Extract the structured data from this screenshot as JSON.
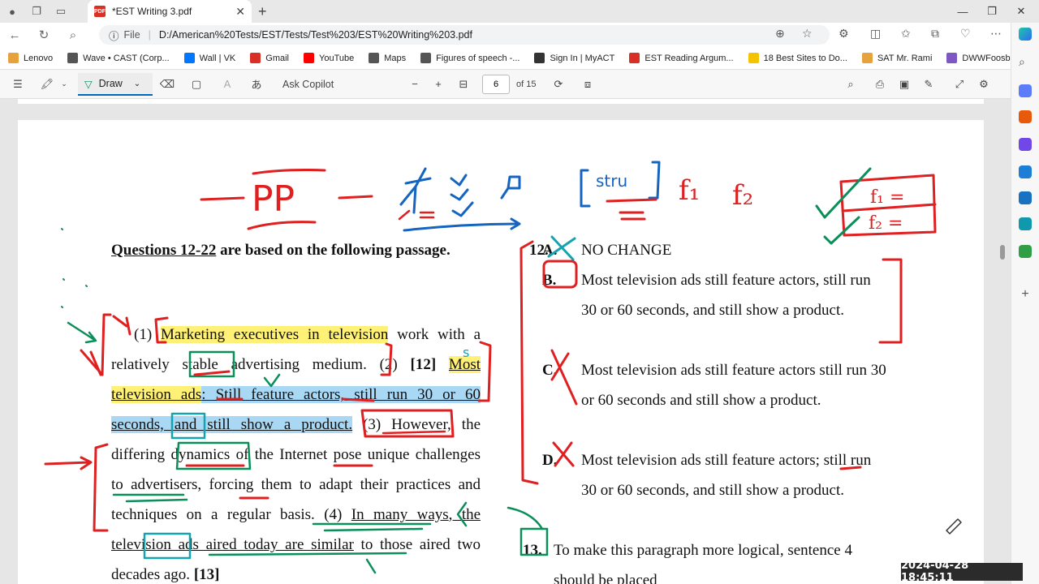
{
  "browser": {
    "tab_title": "*EST Writing 3.pdf",
    "file_label": "File",
    "url": "D:/American%20Tests/EST/Tests/Test%203/EST%20Writing%203.pdf"
  },
  "bookmarks": [
    {
      "label": "Lenovo",
      "color": "#e6a23c"
    },
    {
      "label": "Wave • CAST (Corp...",
      "color": "#555555"
    },
    {
      "label": "Wall | VK",
      "color": "#0077ff"
    },
    {
      "label": "Gmail",
      "color": "#d93025"
    },
    {
      "label": "YouTube",
      "color": "#ff0000"
    },
    {
      "label": "Maps",
      "color": "#555555"
    },
    {
      "label": "Figures of speech -...",
      "color": "#555555"
    },
    {
      "label": "Sign In | MyACT",
      "color": "#333333"
    },
    {
      "label": "EST Reading Argum...",
      "color": "#d93025"
    },
    {
      "label": "18 Best Sites to Do...",
      "color": "#f5c400"
    },
    {
      "label": "SAT Mr. Rami",
      "color": "#e6a23c"
    },
    {
      "label": "DWWFoosball 3D...",
      "color": "#7e57c2"
    }
  ],
  "pdf_toolbar": {
    "draw_label": "Draw",
    "ask_copilot": "Ask Copilot",
    "page_current": "6",
    "page_total": "of 15"
  },
  "document": {
    "questions_range": "Questions 12-22",
    "heading_rest": " are based on the following passage.",
    "s1_num": "(1) ",
    "s1_hl": "Marketing executives in television",
    "s1_rest": " work with a relatively ",
    "s1_word": "stable",
    "s1_end": " advertising medium. ",
    "s2_num": "(2) ",
    "s2_q": "[12] ",
    "s2_a": "Most television ads",
    "s2_b": ": Still feature actors, still run 30 or 60 seconds, and still show a product.",
    "s3": " (3) However, the differing dynamics of the Internet pose unique challenges to advertisers, forcing them to adapt their practices and techniques on a regular basis. ",
    "s4_num": "(4) ",
    "s4_u1": "In many ways",
    "s4_u2": ", the television ads aired today are similar",
    "s4_rest": " to those aired two decades ago. ",
    "s4_q": "[13]",
    "q12_num": "12.",
    "choices": [
      {
        "letter": "A.",
        "text": "NO CHANGE"
      },
      {
        "letter": "B.",
        "text": "Most television ads still feature actors, still run 30 or 60 seconds, and still show a product."
      },
      {
        "letter": "C.",
        "text": "Most television ads still feature actors still run 30 or 60 seconds and still show a product."
      },
      {
        "letter": "D.",
        "text": "Most television ads still feature actors; still run 30 or 60 seconds, and still show a product."
      }
    ],
    "q13_num": "13.",
    "q13_text": "To make this paragraph more logical, sentence 4 should be placed"
  },
  "annotations": {
    "pp": "PP",
    "stru": "[stru]",
    "f1": "f₁",
    "f2": "f₂",
    "box_f1": "f₁ =",
    "box_f2": "f₂ ="
  },
  "timestamp": "2024-04-28  18:45:11",
  "colors": {
    "ink_red": "#e02020",
    "ink_blue": "#1565c0",
    "ink_green": "#0a8f5a",
    "ink_teal": "#16a3b0"
  }
}
